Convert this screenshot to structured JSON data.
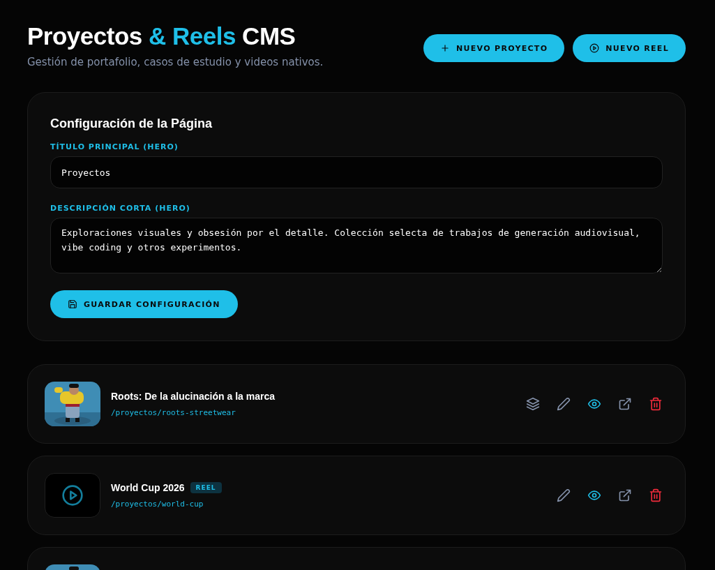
{
  "header": {
    "title_parts": [
      {
        "text": "Proyectos ",
        "accent": false
      },
      {
        "text": "& Reels",
        "accent": true
      },
      {
        "text": " CMS",
        "accent": false
      }
    ],
    "subtitle": "Gestión de portafolio, casos de estudio y videos nativos.",
    "buttons": [
      {
        "kind": "plus",
        "label": "NUEVO PROYECTO"
      },
      {
        "kind": "play",
        "label": "NUEVO REEL"
      }
    ]
  },
  "config": {
    "title": "Configuración de la Página",
    "fields": [
      {
        "kind": "input",
        "label": "TÍTULO PRINCIPAL (HERO)",
        "value": "Proyectos"
      },
      {
        "kind": "textarea",
        "label": "DESCRIPCIÓN CORTA (HERO)",
        "value": "Exploraciones visuales y obsesión por el detalle. Colección selecta de trabajos de generación audiovisual, vibe coding y otros experimentos."
      }
    ],
    "save_button": "GUARDAR CONFIGURACIÓN"
  },
  "projects": [
    {
      "thumbnail": {
        "kind": "picture"
      },
      "title": "Roots: De la alucinación a la marca",
      "path": "/proyectos/roots-streetwear",
      "actions": [
        {
          "kind": "layers"
        },
        {
          "kind": "edit"
        },
        {
          "kind": "view"
        },
        {
          "kind": "open"
        },
        {
          "kind": "delete"
        }
      ]
    },
    {
      "thumbnail": {
        "kind": "reel"
      },
      "title": "World Cup 2026",
      "badge": "REEL",
      "path": "/proyectos/world-cup",
      "actions": [
        {
          "kind": "edit"
        },
        {
          "kind": "view"
        },
        {
          "kind": "open"
        },
        {
          "kind": "delete"
        }
      ]
    },
    {
      "thumbnail": {
        "kind": "picture"
      }
    }
  ]
}
